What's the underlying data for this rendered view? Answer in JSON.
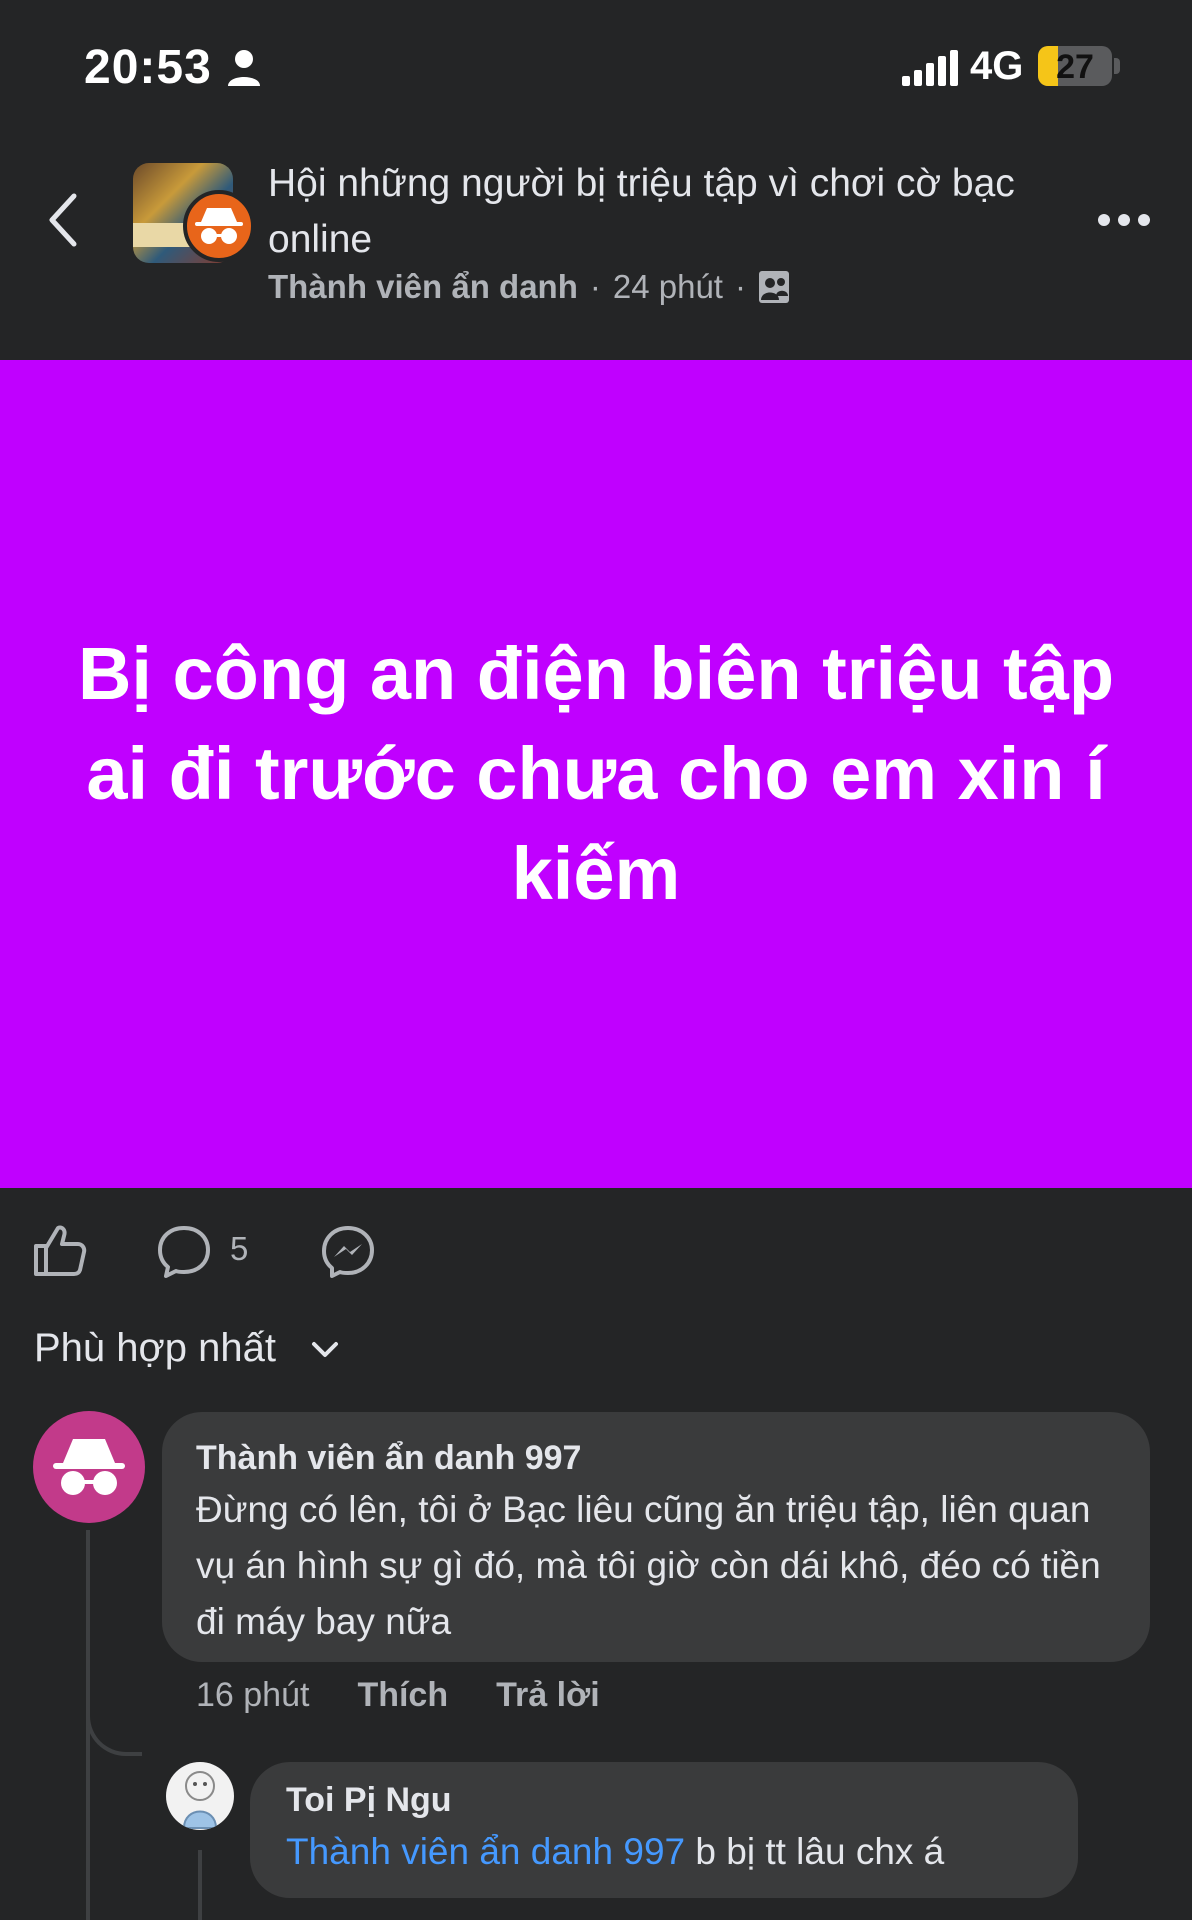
{
  "status_bar": {
    "time": "20:53",
    "network": "4G",
    "battery": "27",
    "battery_level": 0.27
  },
  "header": {
    "title": "Hội những người bị triệu tập vì chơi cờ bạc online",
    "author": "Thành viên ẩn danh",
    "separator": "·",
    "time": "24 phút",
    "icons": {
      "back": "chevron-left-icon",
      "more": "more-dots-icon",
      "audience": "group-members-icon"
    }
  },
  "post": {
    "text": "Bị công an điện biên triệu tập ai đi trước chưa cho em xin í kiếm",
    "background": "#c000ff"
  },
  "actions": {
    "comment_count": "5"
  },
  "sort": {
    "label": "Phù hợp nhất"
  },
  "comments": [
    {
      "author": "Thành viên ẩn danh 997",
      "text": "Đừng có lên, tôi ở Bạc liêu cũng ăn triệu tập, liên quan vụ án hình sự gì đó, mà tôi giờ còn dái khô, đéo có tiền đi máy bay nữa",
      "time": "16 phút",
      "like_label": "Thích",
      "reply_label": "Trả lời"
    },
    {
      "author": "Toi Pị Ngu",
      "mention": "Thành viên ẩn danh 997",
      "text": " b bị tt lâu chx á"
    }
  ],
  "colors": {
    "accent": "#4599ff",
    "background": "#242526",
    "bubble": "#3a3b3c",
    "anon_avatar": "#c23a8a",
    "anon_badge": "#e8651a"
  }
}
